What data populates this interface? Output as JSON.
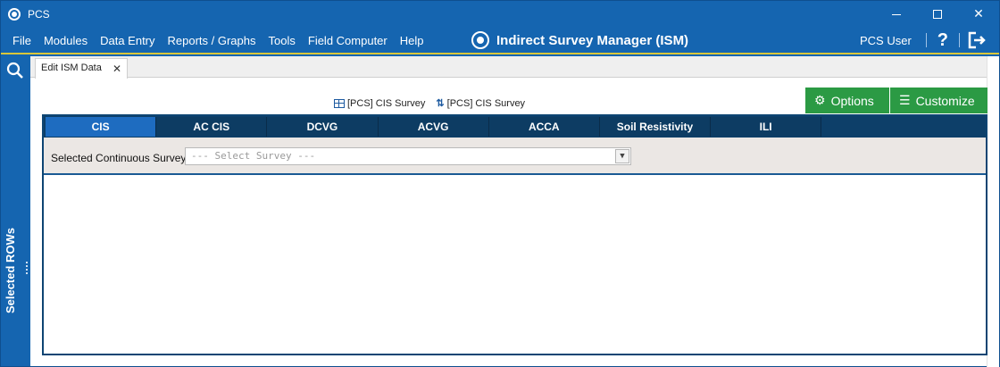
{
  "window": {
    "title": "PCS"
  },
  "menu": {
    "items": [
      "File",
      "Modules",
      "Data Entry",
      "Reports / Graphs",
      "Tools",
      "Field Computer",
      "Help"
    ]
  },
  "header": {
    "title": "Indirect Survey Manager (ISM)",
    "user": "PCS User",
    "help": "?"
  },
  "sidebar": {
    "label": "Selected ROWs"
  },
  "tab": {
    "label": "Edit ISM Data",
    "close": "✕"
  },
  "links": {
    "table_survey": "[PCS] CIS Survey",
    "sort_survey": "[PCS] CIS Survey"
  },
  "buttons": {
    "options": "Options",
    "customize": "Customize"
  },
  "survey_tabs": [
    "CIS",
    "AC CIS",
    "DCVG",
    "ACVG",
    "ACCA",
    "Soil Resistivity",
    "ILI"
  ],
  "selector": {
    "label": "Selected Continuous Survey",
    "placeholder": "--- Select Survey ---"
  },
  "colors": {
    "primary": "#1565b0",
    "accent": "#2b9a44",
    "tab_dark": "#0d3c63",
    "tab_active": "#1e6cc0"
  }
}
